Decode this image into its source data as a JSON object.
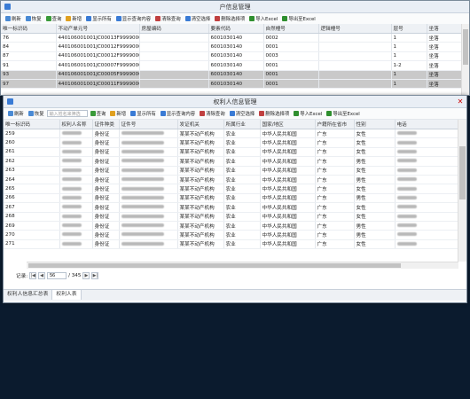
{
  "win1": {
    "title": "户信息管理",
    "toolbar": [
      "刷新",
      "恢复",
      "查询",
      "新增",
      "显示所有",
      "显示查询内容",
      "清除查询",
      "清空选择",
      "删除选择项",
      "导入Excel",
      "导出至Excel"
    ],
    "columns": [
      "唯一标识码",
      "不动产单元号",
      "房屋编码",
      "要素代码",
      "自然幢号",
      "逻辑幢号",
      "层号",
      "坐落"
    ],
    "rows": [
      [
        "76",
        "440106001001JC00013F99990002",
        "",
        "6001030140",
        "0002",
        "",
        "1",
        "坐落"
      ],
      [
        "84",
        "440106001001JC00012F99990001",
        "",
        "6001030140",
        "0001",
        "",
        "1",
        "坐落"
      ],
      [
        "87",
        "440106001001JC00012F99990003",
        "",
        "6001030140",
        "0003",
        "",
        "1",
        "坐落"
      ],
      [
        "91",
        "440106001001JC00007F99990001",
        "",
        "6001030140",
        "0001",
        "",
        "1-2",
        "坐落"
      ],
      [
        "93",
        "440106001001JC00005F99990001",
        "",
        "6001030140",
        "0001",
        "",
        "1",
        "坐落"
      ],
      [
        "97",
        "440106001001JC00011F99990001",
        "",
        "6001030140",
        "0001",
        "",
        "1",
        "坐落"
      ]
    ]
  },
  "win2": {
    "title": "权利人信息管理",
    "toolbar": [
      "刷新",
      "恢复",
      "查询",
      "新增",
      "显示所有",
      "显示查询内容",
      "清除查询",
      "清空选择",
      "删除选择项",
      "导入Excel",
      "导出至Excel"
    ],
    "search_placeholder": "输入姓名来筛选",
    "columns": [
      "唯一标识码",
      "权利人名称",
      "证件种类",
      "证件号",
      "发证机关",
      "所属行业",
      "国家/地区",
      "户籍所在省市",
      "性别",
      "电话"
    ],
    "rows": [
      [
        "259",
        "",
        "身份证",
        "",
        "某某不动产机构",
        "农业",
        "中华人民共和国",
        "广东",
        "女性",
        ""
      ],
      [
        "260",
        "",
        "身份证",
        "",
        "某某不动产机构",
        "农业",
        "中华人民共和国",
        "广东",
        "女性",
        ""
      ],
      [
        "261",
        "",
        "身份证",
        "",
        "某某不动产机构",
        "农业",
        "中华人民共和国",
        "广东",
        "女性",
        ""
      ],
      [
        "262",
        "",
        "身份证",
        "",
        "某某不动产机构",
        "农业",
        "中华人民共和国",
        "广东",
        "男性",
        ""
      ],
      [
        "263",
        "",
        "身份证",
        "",
        "某某不动产机构",
        "农业",
        "中华人民共和国",
        "广东",
        "女性",
        ""
      ],
      [
        "264",
        "",
        "身份证",
        "",
        "某某不动产机构",
        "农业",
        "中华人民共和国",
        "广东",
        "男性",
        ""
      ],
      [
        "265",
        "",
        "身份证",
        "",
        "某某不动产机构",
        "农业",
        "中华人民共和国",
        "广东",
        "女性",
        ""
      ],
      [
        "266",
        "",
        "身份证",
        "",
        "某某不动产机构",
        "农业",
        "中华人民共和国",
        "广东",
        "男性",
        ""
      ],
      [
        "267",
        "",
        "身份证",
        "",
        "某某不动产机构",
        "农业",
        "中华人民共和国",
        "广东",
        "女性",
        ""
      ],
      [
        "268",
        "",
        "身份证",
        "",
        "某某不动产机构",
        "农业",
        "中华人民共和国",
        "广东",
        "女性",
        ""
      ],
      [
        "269",
        "",
        "身份证",
        "",
        "某某不动产机构",
        "农业",
        "中华人民共和国",
        "广东",
        "男性",
        ""
      ],
      [
        "270",
        "",
        "身份证",
        "",
        "某某不动产机构",
        "农业",
        "中华人民共和国",
        "广东",
        "男性",
        ""
      ],
      [
        "271",
        "",
        "身份证",
        "",
        "某某不动产机构",
        "农业",
        "中华人民共和国",
        "广东",
        "女性",
        ""
      ]
    ],
    "pager": {
      "label": "记录:",
      "current": "56",
      "total": "/ 345"
    },
    "tabs": [
      "权利人信息汇总表",
      "权利人表"
    ]
  },
  "colors": {
    "accent": "#3a7bd5",
    "selected_row": "#d8d8d8",
    "background": "#0b1b2e"
  }
}
